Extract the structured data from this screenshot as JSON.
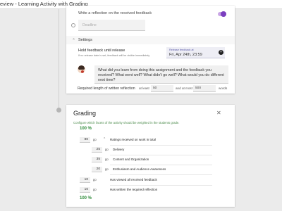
{
  "header": {
    "title": "eview - Learning Activity with Grading"
  },
  "reflection": {
    "label": "Write a reflection on the received feedback"
  },
  "deadline": {
    "placeholder": "Deadline"
  },
  "settings": {
    "label": "Settings",
    "hold_label": "Hold feedback until release",
    "hold_sub": "If no release date is set, feedback will be visible immediately",
    "release_caption": "Release feedback at",
    "release_value": "Fri, Apr 24th, 23:59",
    "question": "What did you learn from doing this assignment and the feedback you received? What went well? What didn't go well? What would you do different next time?",
    "length_label": "Required length of written reflection",
    "at_least_label": "at least",
    "min_words": "50",
    "at_most_label": "and at most",
    "max_words": "500",
    "words_label": "words"
  },
  "grading": {
    "title": "Grading",
    "description": "Configure which facets of the activity should be weighted in the students grade.",
    "total_top": "100 %",
    "total_bottom": "100 %",
    "unit": "pp",
    "rows": [
      {
        "value": "80",
        "name": "Ratings received on work in total"
      },
      {
        "value": "25",
        "name": "Delivery"
      },
      {
        "value": "35",
        "name": "Content and Organization"
      },
      {
        "value": "20",
        "name": "Enthusiasm and Audience Awareness"
      },
      {
        "value": "10",
        "name": "Has viewed all received feedback"
      },
      {
        "value": "10",
        "name": "Has written the required reflection"
      }
    ]
  },
  "colors": {
    "accent": "#7b3fbf",
    "success": "#2e8b3a"
  }
}
